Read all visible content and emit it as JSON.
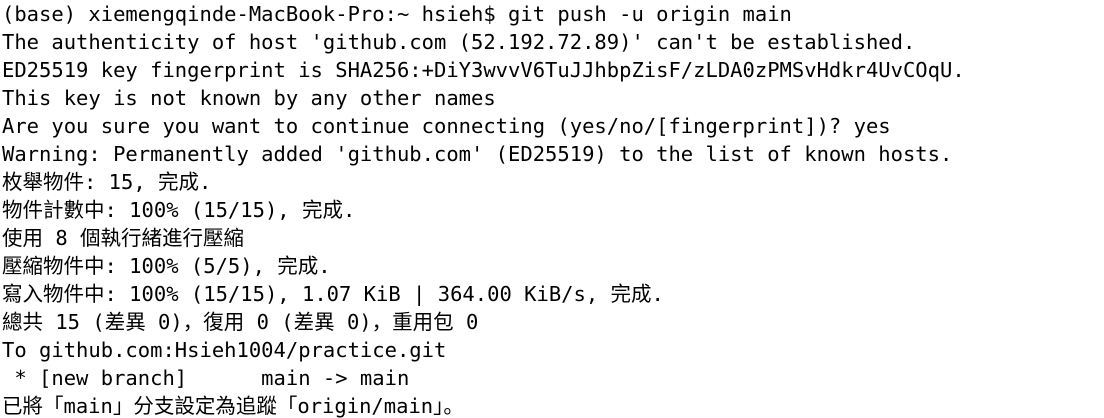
{
  "terminal": {
    "lines": [
      "(base) xiemengqinde-MacBook-Pro:~ hsieh$ git push -u origin main",
      "The authenticity of host 'github.com (52.192.72.89)' can't be established.",
      "ED25519 key fingerprint is SHA256:+DiY3wvvV6TuJJhbpZisF/zLDA0zPMSvHdkr4UvCOqU.",
      "This key is not known by any other names",
      "Are you sure you want to continue connecting (yes/no/[fingerprint])? yes",
      "Warning: Permanently added 'github.com' (ED25519) to the list of known hosts.",
      "枚舉物件: 15, 完成.",
      "物件計數中: 100% (15/15), 完成.",
      "使用 8 個執行緒進行壓縮",
      "壓縮物件中: 100% (5/5), 完成.",
      "寫入物件中: 100% (15/15), 1.07 KiB | 364.00 KiB/s, 完成.",
      "總共 15 (差異 0)，復用 0 (差異 0)，重用包 0",
      "To github.com:Hsieh1004/practice.git",
      " * [new branch]      main -> main",
      "已將「main」分支設定為追蹤「origin/main」。"
    ]
  }
}
